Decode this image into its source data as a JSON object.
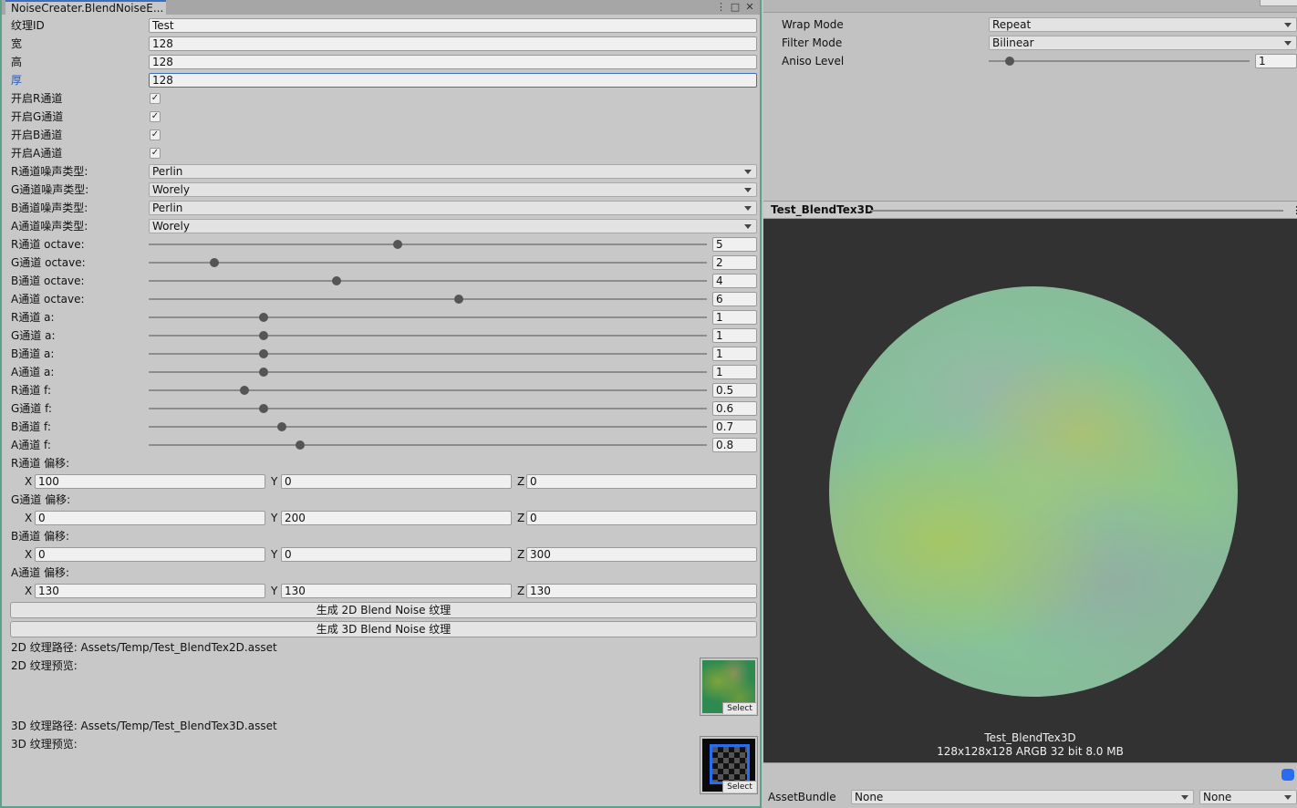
{
  "window": {
    "tab_title": "NoiseCreater.BlendNoiseE...",
    "menu_icon": "⋮",
    "maximize_icon": "□",
    "close_icon": "✕"
  },
  "fields": {
    "texture_id_label": "纹理ID",
    "texture_id_value": "Test",
    "width_label": "宽",
    "width_value": "128",
    "height_label": "高",
    "height_value": "128",
    "depth_label": "厚",
    "depth_value": "128"
  },
  "channels": {
    "enable_r_label": "开启R通道",
    "enable_r": true,
    "enable_g_label": "开启G通道",
    "enable_g": true,
    "enable_b_label": "开启B通道",
    "enable_b": true,
    "enable_a_label": "开启A通道",
    "enable_a": true,
    "check_glyph": "✓"
  },
  "noise_types": [
    {
      "label": "R通道噪声类型:",
      "value": "Perlin"
    },
    {
      "label": "G通道噪声类型:",
      "value": "Worely"
    },
    {
      "label": "B通道噪声类型:",
      "value": "Perlin"
    },
    {
      "label": "A通道噪声类型:",
      "value": "Worely"
    }
  ],
  "sliders": [
    {
      "label": "R通道 octave:",
      "value": "5"
    },
    {
      "label": "G通道 octave:",
      "value": "2"
    },
    {
      "label": "B通道 octave:",
      "value": "4"
    },
    {
      "label": "A通道 octave:",
      "value": "6"
    },
    {
      "label": "R通道 a:",
      "value": "1"
    },
    {
      "label": "G通道 a:",
      "value": "1"
    },
    {
      "label": "B通道 a:",
      "value": "1"
    },
    {
      "label": "A通道 a:",
      "value": "1"
    },
    {
      "label": "R通道 f:",
      "value": "0.5"
    },
    {
      "label": "G通道 f:",
      "value": "0.6"
    },
    {
      "label": "B通道 f:",
      "value": "0.7"
    },
    {
      "label": "A通道 f:",
      "value": "0.8"
    }
  ],
  "offsets": [
    {
      "label": "R通道 偏移:",
      "x": "100",
      "y": "0",
      "z": "0"
    },
    {
      "label": "G通道 偏移:",
      "x": "0",
      "y": "200",
      "z": "0"
    },
    {
      "label": "B通道 偏移:",
      "x": "0",
      "y": "0",
      "z": "300"
    },
    {
      "label": "A通道 偏移:",
      "x": "130",
      "y": "130",
      "z": "130"
    }
  ],
  "axis_labels": {
    "x": "X",
    "y": "Y",
    "z": "Z"
  },
  "buttons": {
    "gen_2d": "生成 2D Blend Noise 纹理",
    "gen_3d": "生成 3D Blend Noise 纹理"
  },
  "output": {
    "path_2d": "2D 纹理路径:  Assets/Temp/Test_BlendTex2D.asset",
    "preview_2d_label": "2D 纹理预览:",
    "path_3d": "3D 纹理路径:  Assets/Temp/Test_BlendTex3D.asset",
    "preview_3d_label": "3D 纹理预览:",
    "select_label": "Select"
  },
  "inspector": {
    "wrap_mode_label": "Wrap Mode",
    "wrap_mode_value": "Repeat",
    "filter_mode_label": "Filter Mode",
    "filter_mode_value": "Bilinear",
    "aniso_level_label": "Aniso Level",
    "aniso_level_value": "1",
    "preview_title": "Test_BlendTex3D",
    "preview_caption_name": "Test_BlendTex3D",
    "preview_caption_info": "128x128x128 ARGB 32 bit 8.0 MB",
    "asset_bundle_label": "AssetBundle",
    "asset_bundle_value": "None",
    "asset_bundle_variant": "None"
  }
}
